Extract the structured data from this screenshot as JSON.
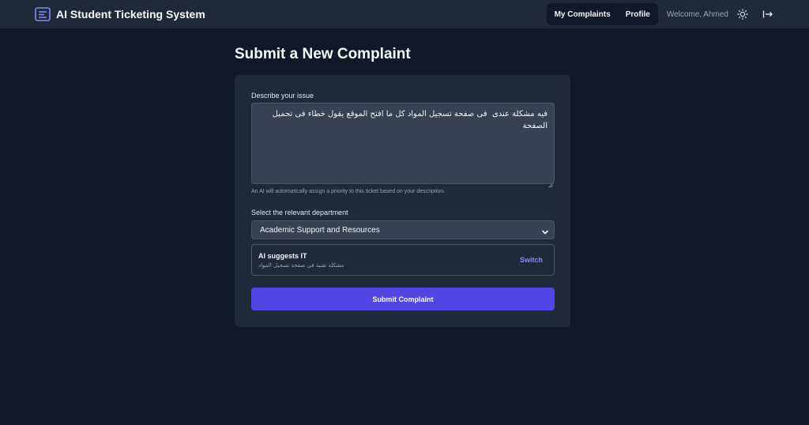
{
  "header": {
    "title": "AI Student Ticketing System",
    "brand_icon": "ticket-list-icon",
    "nav": {
      "my_complaints": "My Complaints",
      "profile": "Profile"
    },
    "welcome": "Welcome, Ahmed",
    "theme_icon": "sun-icon",
    "logout_icon": "logout-icon"
  },
  "page": {
    "title": "Submit a New Complaint"
  },
  "form": {
    "issue_label": "Describe your issue",
    "issue_value": "فيه مشكلة عندى  فى صفحة تسجيل المواد كل ما افتح الموقع يقول خطاء فى تحميل الصفحة",
    "issue_hint": "An AI will automatically assign a priority to this ticket based on your description.",
    "department_label": "Select the relevant department",
    "department_selected": "Academic Support and Resources",
    "suggestion": {
      "title": "AI suggests IT",
      "reason": "مشكلة تقنية في صفحة تسجيل المواد",
      "switch_label": "Switch"
    },
    "submit_label": "Submit Complaint"
  },
  "colors": {
    "background": "#111827",
    "surface": "#1f2937",
    "input": "#374151",
    "accent": "#4f46e5",
    "link": "#818cf8"
  }
}
